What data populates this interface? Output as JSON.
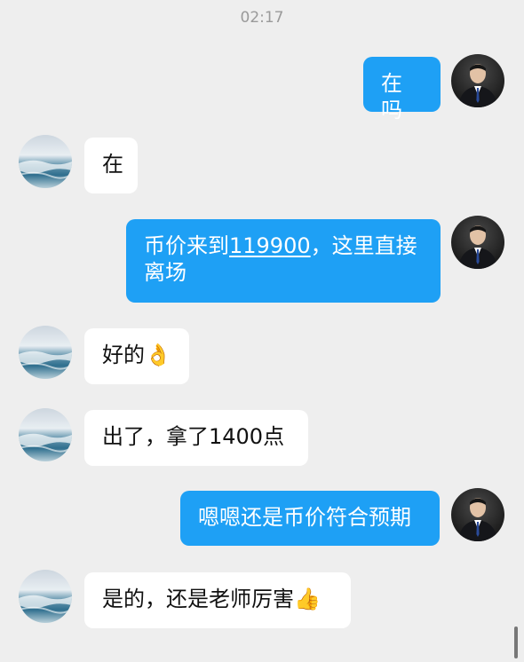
{
  "header": {
    "time": "02:17"
  },
  "messages": {
    "m1": {
      "text": "在吗"
    },
    "m2": {
      "text": "在"
    },
    "m3": {
      "before": "币价来到",
      "link": "119900",
      "after": "，这里直接",
      "line2": "离场"
    },
    "m4": {
      "text": "好的",
      "emoji": "👌"
    },
    "m5": {
      "text": "出了，拿了1400点"
    },
    "m6": {
      "text": "嗯嗯还是币价符合预期"
    },
    "m7": {
      "text": "是的，还是老师厉害",
      "emoji": "👍"
    }
  },
  "icons": {
    "mentor_avatar": "man-in-suit-avatar",
    "friend_avatar": "ocean-wave-avatar",
    "ok_emoji": "ok-hand-emoji",
    "thumbs_emoji": "thumbs-up-emoji"
  },
  "colors": {
    "outgoing_bubble": "#1ea0f5",
    "incoming_bubble": "#ffffff",
    "background": "#eeeeee"
  }
}
